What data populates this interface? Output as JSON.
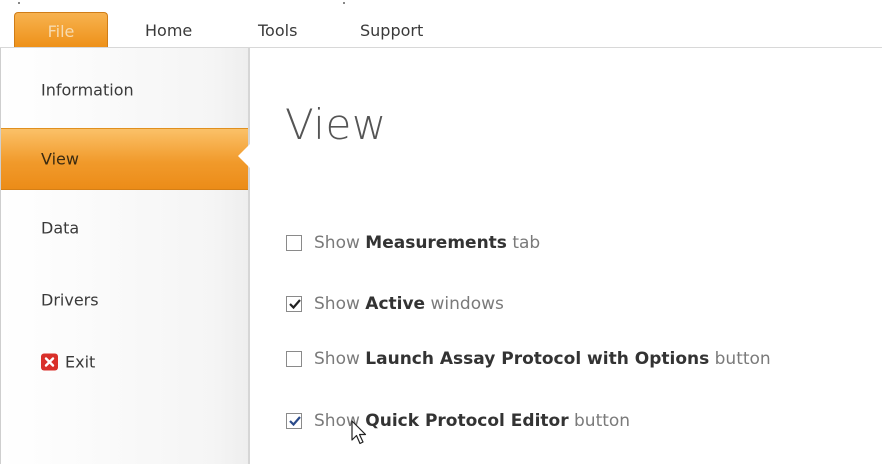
{
  "ribbon": {
    "tabs": [
      {
        "label": "File"
      },
      {
        "label": "Home"
      },
      {
        "label": "Tools"
      },
      {
        "label": "Support"
      }
    ]
  },
  "sidebar": {
    "items": [
      {
        "label": "Information"
      },
      {
        "label": "View",
        "selected": true
      },
      {
        "label": "Data"
      },
      {
        "label": "Drivers"
      },
      {
        "label": "Exit",
        "icon": "exit-icon"
      }
    ]
  },
  "main": {
    "title": "View",
    "options": [
      {
        "prefix": "Show ",
        "bold": "Measurements",
        "suffix": " tab",
        "checked": false
      },
      {
        "prefix": "Show ",
        "bold": "Active",
        "suffix": " windows",
        "checked": true
      },
      {
        "prefix": "Show ",
        "bold": "Launch Assay Protocol with Options",
        "suffix": " button",
        "checked": false
      },
      {
        "prefix": "Show ",
        "bold": "Quick Protocol Editor",
        "suffix": " button",
        "checked": true
      }
    ]
  },
  "colors": {
    "accent": "#f19a2b",
    "exit_icon": "#d9302a"
  }
}
